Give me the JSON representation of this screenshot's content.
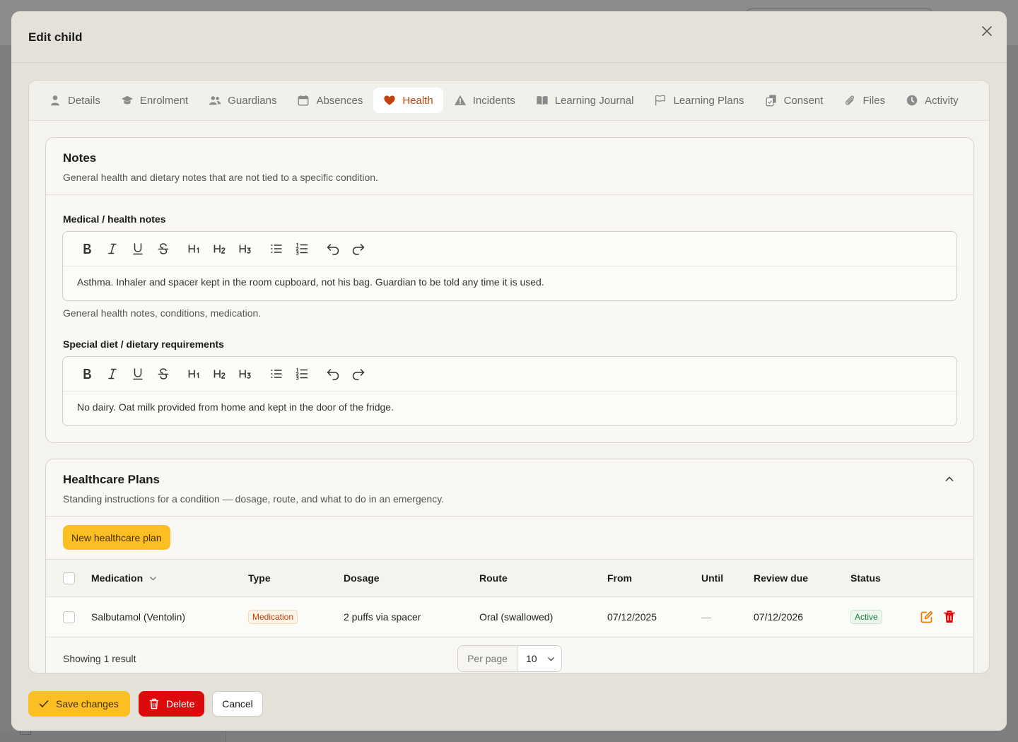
{
  "modal": {
    "title": "Edit child"
  },
  "tabs": [
    {
      "label": "Details",
      "icon": "user-icon",
      "active": false
    },
    {
      "label": "Enrolment",
      "icon": "graduation-cap-icon",
      "active": false
    },
    {
      "label": "Guardians",
      "icon": "users-icon",
      "active": false
    },
    {
      "label": "Absences",
      "icon": "calendar-icon",
      "active": false
    },
    {
      "label": "Health",
      "icon": "heart-icon",
      "active": true
    },
    {
      "label": "Incidents",
      "icon": "warning-triangle-icon",
      "active": false
    },
    {
      "label": "Learning Journal",
      "icon": "book-icon",
      "active": false
    },
    {
      "label": "Learning Plans",
      "icon": "flag-icon",
      "active": false
    },
    {
      "label": "Consent",
      "icon": "document-check-icon",
      "active": false
    },
    {
      "label": "Files",
      "icon": "paperclip-icon",
      "active": false
    },
    {
      "label": "Activity",
      "icon": "clock-icon",
      "active": false
    }
  ],
  "notes": {
    "title": "Notes",
    "description": "General health and dietary notes that are not tied to a specific condition.",
    "medical": {
      "label": "Medical / health notes",
      "value": "Asthma. Inhaler and spacer kept in the room cupboard, not his bag. Guardian to be told any time it is used.",
      "help": "General health notes, conditions, medication."
    },
    "diet": {
      "label": "Special diet / dietary requirements",
      "value": "No dairy. Oat milk provided from home and kept in the door of the fridge."
    }
  },
  "toolbar": {
    "bold": "B",
    "italic": "I",
    "underline": "U",
    "strike": "S",
    "h1": "H1",
    "h2": "H2",
    "h3": "H3"
  },
  "healthcare": {
    "title": "Healthcare Plans",
    "description": "Standing instructions for a condition — dosage, route, and what to do in an emergency.",
    "new_button": "New healthcare plan",
    "columns": {
      "medication": "Medication",
      "type": "Type",
      "dosage": "Dosage",
      "route": "Route",
      "from": "From",
      "until": "Until",
      "review_due": "Review due",
      "status": "Status"
    },
    "rows": [
      {
        "medication": "Salbutamol (Ventolin)",
        "type": "Medication",
        "dosage": "2 puffs via spacer",
        "route": "Oral (swallowed)",
        "from": "07/12/2025",
        "until": "—",
        "review_due": "07/12/2026",
        "status": "Active"
      }
    ],
    "showing": "Showing 1 result",
    "per_page_label": "Per page",
    "per_page_value": "10"
  },
  "footer": {
    "save": "Save changes",
    "delete": "Delete",
    "cancel": "Cancel"
  },
  "colors": {
    "accent": "#fbbf24",
    "active_tab": "#c2410c",
    "danger": "#dc0a0a",
    "success": "#15803d"
  }
}
